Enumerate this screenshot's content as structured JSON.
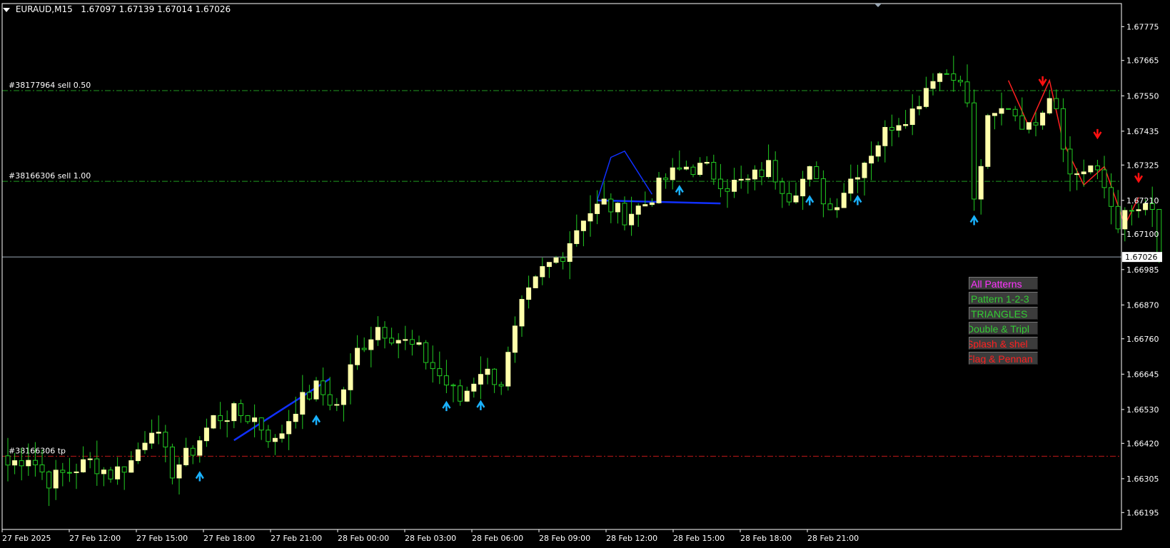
{
  "header": {
    "symbol_tf": "EURAUD,M15",
    "ohlc": "1.67097 1.67139 1.67014 1.67026"
  },
  "colors": {
    "background": "#000000",
    "axis": "#ffffff",
    "bull": "#ffffaa",
    "wick": "#22cc22",
    "order_line": "#1f9a1f",
    "tp_line": "#c01818",
    "price_line": "#9aa7b5",
    "pattern_blue": "#1030ff",
    "pattern_red": "#ff2020",
    "arrow_up": "#1ab2ff",
    "arrow_down": "#ff1010"
  },
  "orders": [
    {
      "label": "#38177964 sell 0.50",
      "price": 1.67567
    },
    {
      "label": "#38166306 sell 1.00",
      "price": 1.67272
    },
    {
      "label": "#38166306 tp",
      "price": 1.66378
    }
  ],
  "current_price": {
    "label": "1.67026",
    "value": 1.67026
  },
  "y_axis_ticks": [
    "1.67775",
    "1.67665",
    "1.67550",
    "1.67435",
    "1.67325",
    "1.67210",
    "1.67100",
    "1.66985",
    "1.66870",
    "1.66760",
    "1.66645",
    "1.66530",
    "1.66420",
    "1.66305",
    "1.66195"
  ],
  "x_axis_ticks": [
    "27 Feb 2025",
    "27 Feb 12:00",
    "27 Feb 15:00",
    "27 Feb 18:00",
    "27 Feb 21:00",
    "28 Feb 00:00",
    "28 Feb 03:00",
    "28 Feb 06:00",
    "28 Feb 09:00",
    "28 Feb 12:00",
    "28 Feb 15:00",
    "28 Feb 18:00",
    "28 Feb 21:00"
  ],
  "panel": [
    {
      "label": "All Patterns",
      "color": "#ff33ff"
    },
    {
      "label": "Pattern 1-2-3",
      "color": "#33cc33"
    },
    {
      "label": "TRIANGLES",
      "color": "#33cc33"
    },
    {
      "label": "Double & Tripl",
      "color": "#33cc33"
    },
    {
      "label": "Splash & shel",
      "color": "#ff2020"
    },
    {
      "label": "Flag & Pennan",
      "color": "#ff2020"
    }
  ],
  "chart_data": {
    "type": "candlestick",
    "symbol": "EURAUD",
    "timeframe": "M15",
    "ylim": [
      1.6614,
      1.6785
    ],
    "close_path": [
      [
        0,
        1.6635
      ],
      [
        3,
        1.6638
      ],
      [
        6,
        1.663
      ],
      [
        9,
        1.6633
      ],
      [
        12,
        1.6636
      ],
      [
        15,
        1.6632
      ],
      [
        18,
        1.6636
      ],
      [
        21,
        1.6648
      ],
      [
        24,
        1.6633
      ],
      [
        27,
        1.664
      ],
      [
        30,
        1.665
      ],
      [
        33,
        1.6652
      ],
      [
        36,
        1.665
      ],
      [
        39,
        1.6642
      ],
      [
        42,
        1.6654
      ],
      [
        45,
        1.666
      ],
      [
        48,
        1.6654
      ],
      [
        51,
        1.6672
      ],
      [
        54,
        1.668
      ],
      [
        57,
        1.6676
      ],
      [
        60,
        1.6672
      ],
      [
        63,
        1.6664
      ],
      [
        66,
        1.6656
      ],
      [
        69,
        1.6666
      ],
      [
        72,
        1.6662
      ],
      [
        75,
        1.6686
      ],
      [
        78,
        1.6698
      ],
      [
        81,
        1.6704
      ],
      [
        84,
        1.6716
      ],
      [
        87,
        1.672
      ],
      [
        90,
        1.6716
      ],
      [
        93,
        1.672
      ],
      [
        96,
        1.6728
      ],
      [
        99,
        1.6732
      ],
      [
        102,
        1.6731
      ],
      [
        105,
        1.6726
      ],
      [
        108,
        1.6727
      ],
      [
        111,
        1.6732
      ],
      [
        114,
        1.6723
      ],
      [
        117,
        1.673
      ],
      [
        120,
        1.6718
      ],
      [
        123,
        1.6728
      ],
      [
        126,
        1.6737
      ],
      [
        129,
        1.6746
      ],
      [
        132,
        1.675
      ],
      [
        135,
        1.6762
      ],
      [
        138,
        1.6763
      ],
      [
        140,
        1.6753
      ],
      [
        141,
        1.672
      ],
      [
        143,
        1.6746
      ],
      [
        146,
        1.6752
      ],
      [
        149,
        1.6744
      ],
      [
        152,
        1.6756
      ],
      [
        153,
        1.6752
      ],
      [
        155,
        1.6729
      ],
      [
        158,
        1.6732
      ],
      [
        160,
        1.6725
      ],
      [
        162,
        1.6714
      ],
      [
        165,
        1.6718
      ],
      [
        167,
        1.6717
      ],
      [
        168,
        1.67026
      ]
    ],
    "arrows_up_at_bar": [
      28,
      45,
      64,
      69,
      98,
      117,
      124,
      141
    ],
    "arrows_down_at_bar": [
      151,
      159,
      165
    ]
  }
}
